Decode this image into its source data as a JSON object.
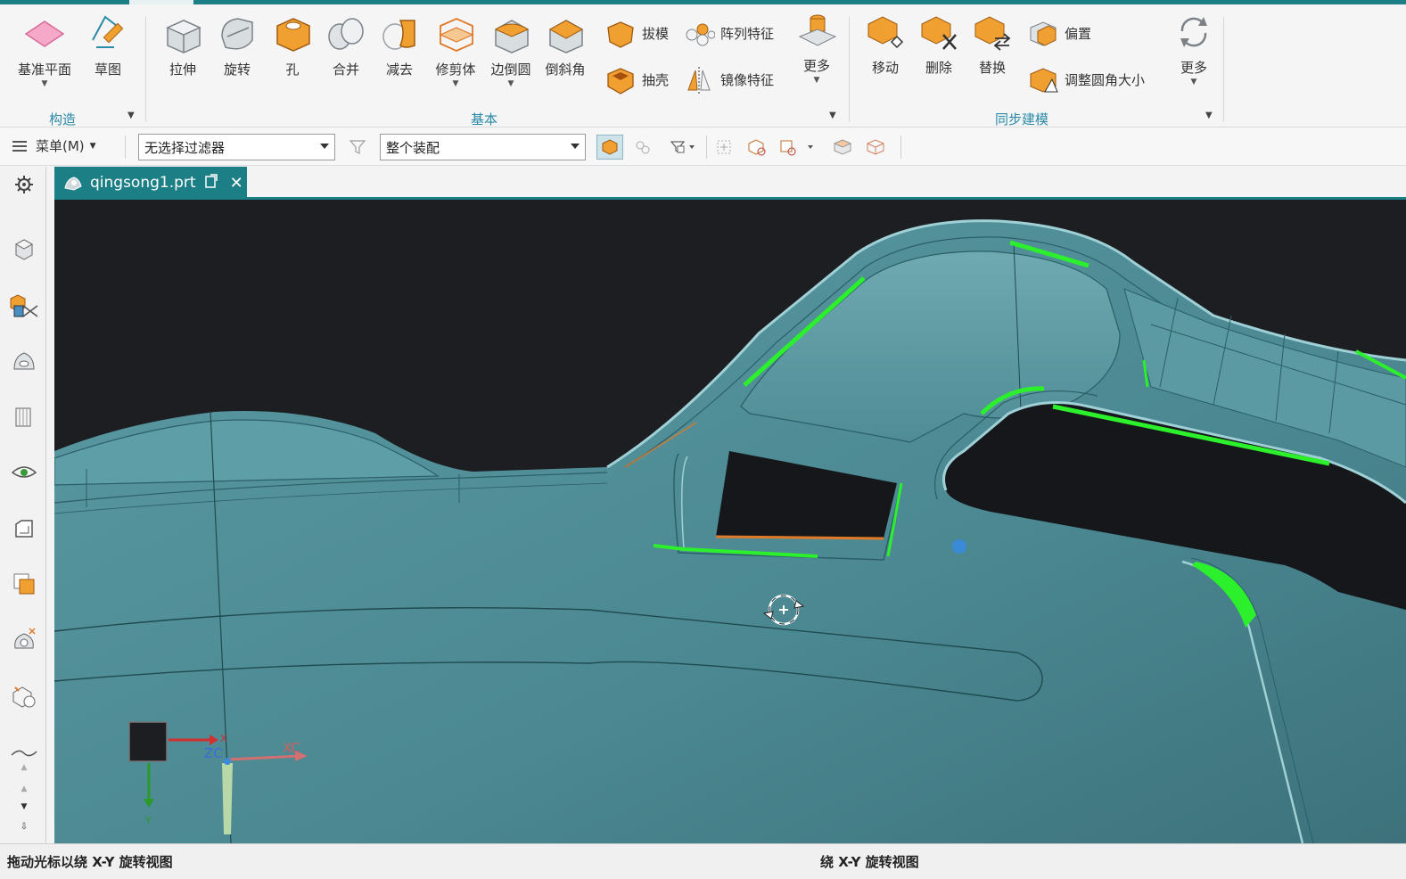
{
  "ribbon": {
    "construct_group": {
      "label": "构造",
      "items": [
        {
          "label": "基准平面"
        },
        {
          "label": "草图"
        }
      ]
    },
    "basic_group": {
      "label": "基本",
      "items": [
        {
          "label": "拉伸"
        },
        {
          "label": "旋转"
        },
        {
          "label": "孔"
        },
        {
          "label": "合并"
        },
        {
          "label": "减去"
        },
        {
          "label": "修剪体"
        },
        {
          "label": "边倒圆"
        },
        {
          "label": "倒斜角"
        }
      ],
      "small_items": [
        {
          "label": "拔模"
        },
        {
          "label": "抽壳"
        },
        {
          "label": "阵列特征"
        },
        {
          "label": "镜像特征"
        }
      ],
      "more_label": "更多"
    },
    "sync_group": {
      "label": "同步建模",
      "items": [
        {
          "label": "移动"
        },
        {
          "label": "删除"
        },
        {
          "label": "替换"
        }
      ],
      "small_items": [
        {
          "label": "偏置"
        },
        {
          "label": "调整圆角大小"
        }
      ],
      "more_label": "更多"
    }
  },
  "cmdbar": {
    "menu_label": "菜单(M)",
    "filter_value": "无选择过滤器",
    "scope_value": "整个装配"
  },
  "tab": {
    "filename": "qingsong1.prt",
    "close_glyph": "✕"
  },
  "viewport": {
    "axis_labels": {
      "zc": "ZC",
      "xc": "XC",
      "x": "X",
      "y": "Y"
    }
  },
  "status": {
    "left": "拖动光标以绕 X-Y 旋转视图",
    "mid": "绕 X-Y 旋转视图"
  },
  "colors": {
    "accent": "#1d7f86",
    "model": "#4f8f98",
    "highlight_green": "#2cf02c",
    "highlight_orange": "#e07a2a",
    "background": "#1c1e22"
  }
}
